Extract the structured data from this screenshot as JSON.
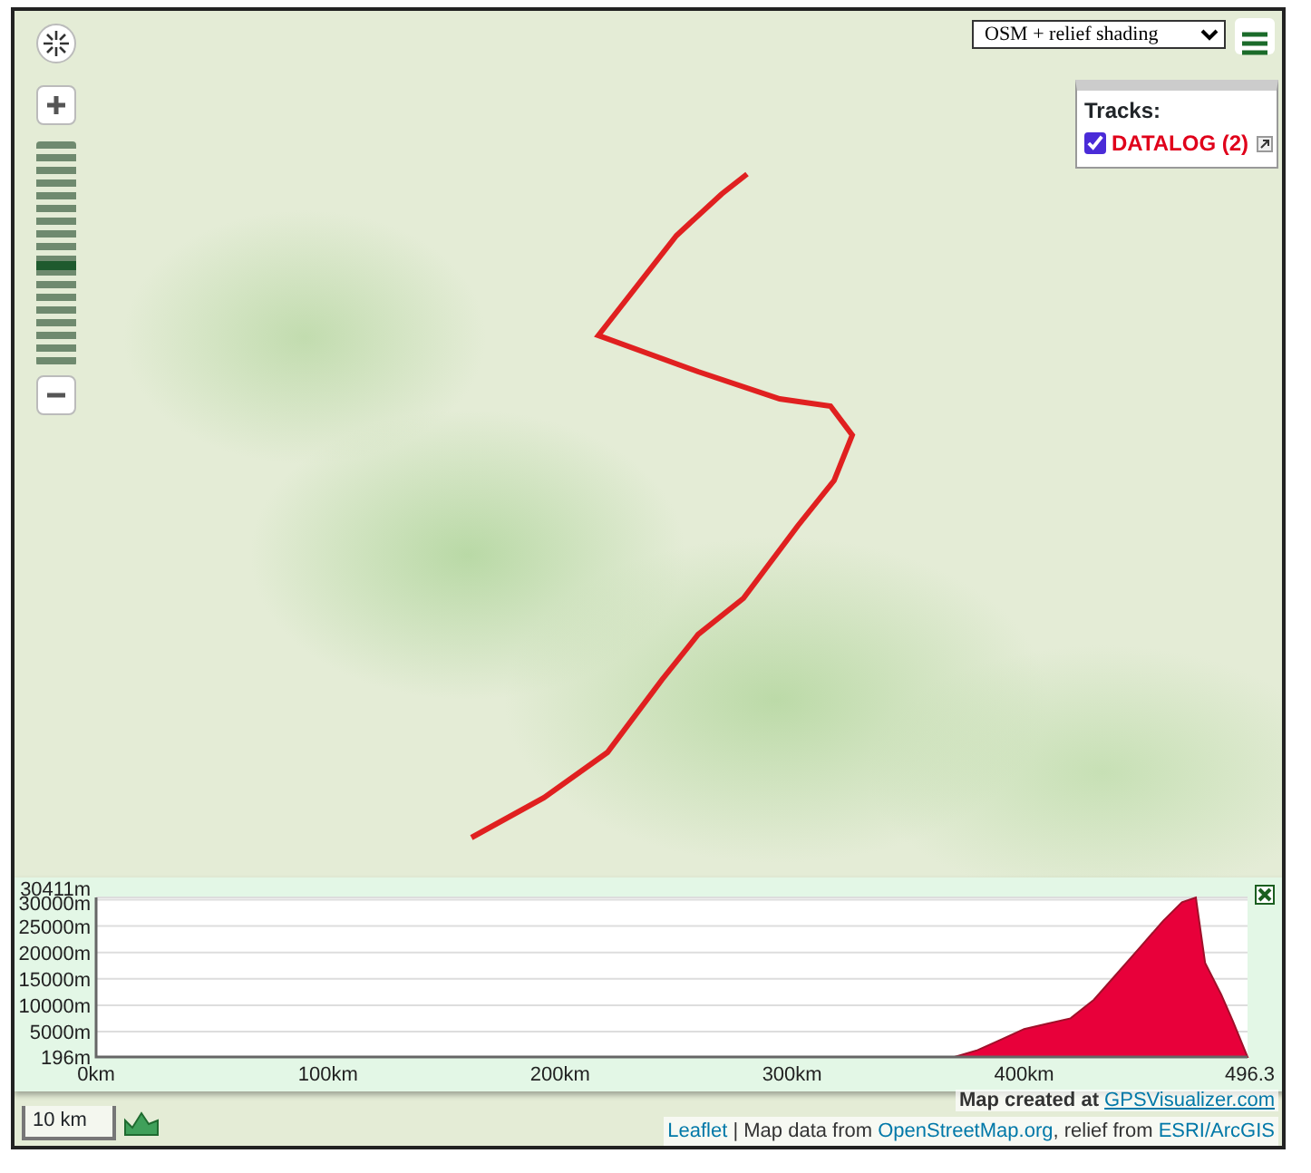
{
  "map": {
    "layer_select": {
      "value": "OSM + relief shading"
    },
    "tracks_panel": {
      "title": "Tracks:",
      "tracks": [
        {
          "name": "DATALOG (2)",
          "checked": true,
          "color": "#e0001a"
        }
      ]
    },
    "zoom_slider": {
      "level": 0.43
    },
    "scale": "10 km"
  },
  "profile": {
    "chart_data": {
      "type": "area",
      "x": [
        0,
        50,
        100,
        150,
        200,
        250,
        300,
        350,
        370,
        380,
        390,
        400,
        410,
        420,
        430,
        440,
        450,
        460,
        468,
        474,
        478,
        485,
        490,
        496.3
      ],
      "grid": true,
      "series": [
        {
          "color": "#e8003a",
          "values": [
            196,
            196,
            196,
            196,
            196,
            196,
            196,
            196,
            196,
            1500,
            3500,
            5500,
            6500,
            7500,
            11000,
            16000,
            21000,
            26000,
            29500,
            30411,
            18000,
            12000,
            7000,
            196
          ]
        }
      ],
      "xlim": [
        0,
        496.3
      ],
      "ylim": [
        196,
        30411
      ],
      "xticks": [
        {
          "value": 0,
          "label": "0km"
        },
        {
          "value": 100,
          "label": "100km"
        },
        {
          "value": 200,
          "label": "200km"
        },
        {
          "value": 300,
          "label": "300km"
        },
        {
          "value": 400,
          "label": "400km"
        },
        {
          "value": 496.3,
          "label": "496.3"
        }
      ],
      "yticks": [
        {
          "value": 196,
          "label": "196m"
        },
        {
          "value": 5000,
          "label": "5000m"
        },
        {
          "value": 10000,
          "label": "10000m"
        },
        {
          "value": 15000,
          "label": "15000m"
        },
        {
          "value": 20000,
          "label": "20000m"
        },
        {
          "value": 25000,
          "label": "25000m"
        },
        {
          "value": 30000,
          "label": "30000m"
        },
        {
          "value": 30411,
          "label": "30411m"
        }
      ]
    }
  },
  "attribution": {
    "credit_prefix": "Map created at",
    "credit_link": "GPSVisualizer.com",
    "parts": [
      {
        "kind": "link",
        "text": "Leaflet"
      },
      {
        "kind": "text",
        "text": " | Map data from "
      },
      {
        "kind": "link",
        "text": "OpenStreetMap.org"
      },
      {
        "kind": "text",
        "text": ", relief from "
      },
      {
        "kind": "link",
        "text": "ESRI/ArcGIS"
      }
    ]
  }
}
